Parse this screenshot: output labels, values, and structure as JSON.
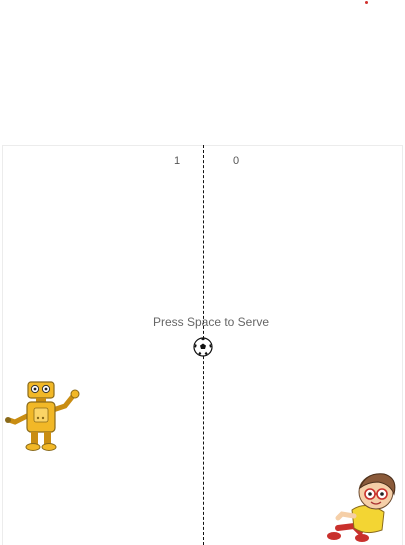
{
  "scoreboard": {
    "left_score": "1",
    "right_score": "0"
  },
  "message": {
    "serve_prompt": "Press Space to Serve"
  },
  "sprites": {
    "left_player": "robot-sprite",
    "right_player": "cartoon-kid-sprite",
    "ball": "soccer-ball-icon"
  },
  "colors": {
    "robot_body": "#f2b827",
    "net": "#111111",
    "kid_shirt": "#f3d533",
    "dot": "#d0312d"
  }
}
